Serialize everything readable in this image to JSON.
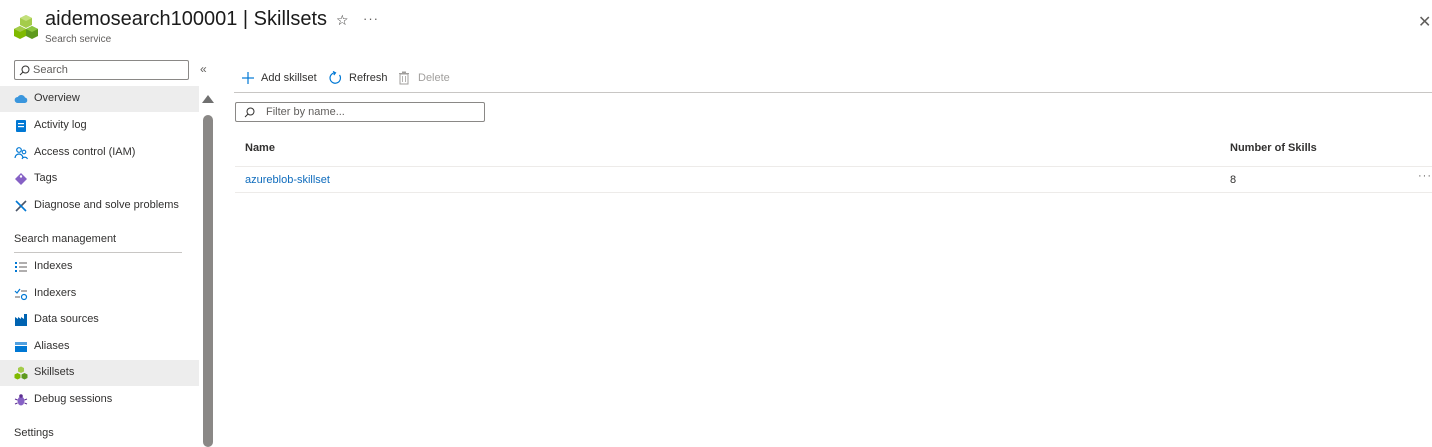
{
  "header": {
    "title": "aidemosearch100001 | Skillsets",
    "subtitle": "Search service",
    "favorite_icon": "star-icon",
    "more_icon": "ellipsis-icon",
    "close_icon": "close-icon"
  },
  "sidebar": {
    "search_placeholder": "Search",
    "collapse_icon": "double-chevron-left-icon",
    "items": [
      {
        "label": "Overview",
        "icon": "cloud-icon",
        "selected": false,
        "hover": true
      },
      {
        "label": "Activity log",
        "icon": "activity-log-icon"
      },
      {
        "label": "Access control (IAM)",
        "icon": "people-icon"
      },
      {
        "label": "Tags",
        "icon": "tag-icon"
      },
      {
        "label": "Diagnose and solve problems",
        "icon": "wrench-icon"
      }
    ],
    "section_search_management": "Search management",
    "mgmt_items": [
      {
        "label": "Indexes",
        "icon": "list-icon"
      },
      {
        "label": "Indexers",
        "icon": "indexer-icon"
      },
      {
        "label": "Data sources",
        "icon": "factory-icon"
      },
      {
        "label": "Aliases",
        "icon": "alias-icon"
      },
      {
        "label": "Skillsets",
        "icon": "cubes-icon",
        "selected": true
      },
      {
        "label": "Debug sessions",
        "icon": "bug-icon"
      }
    ],
    "section_settings": "Settings"
  },
  "toolbar": {
    "add_label": "Add skillset",
    "refresh_label": "Refresh",
    "delete_label": "Delete"
  },
  "filter": {
    "placeholder": "Filter by name..."
  },
  "table": {
    "columns": [
      "Name",
      "Number of Skills"
    ],
    "rows": [
      {
        "name": "azureblob-skillset",
        "skills": "8"
      }
    ]
  },
  "colors": {
    "accent_link": "#0f6cbd",
    "selected_bg": "#ededed",
    "brand_green": "#7fba00"
  }
}
